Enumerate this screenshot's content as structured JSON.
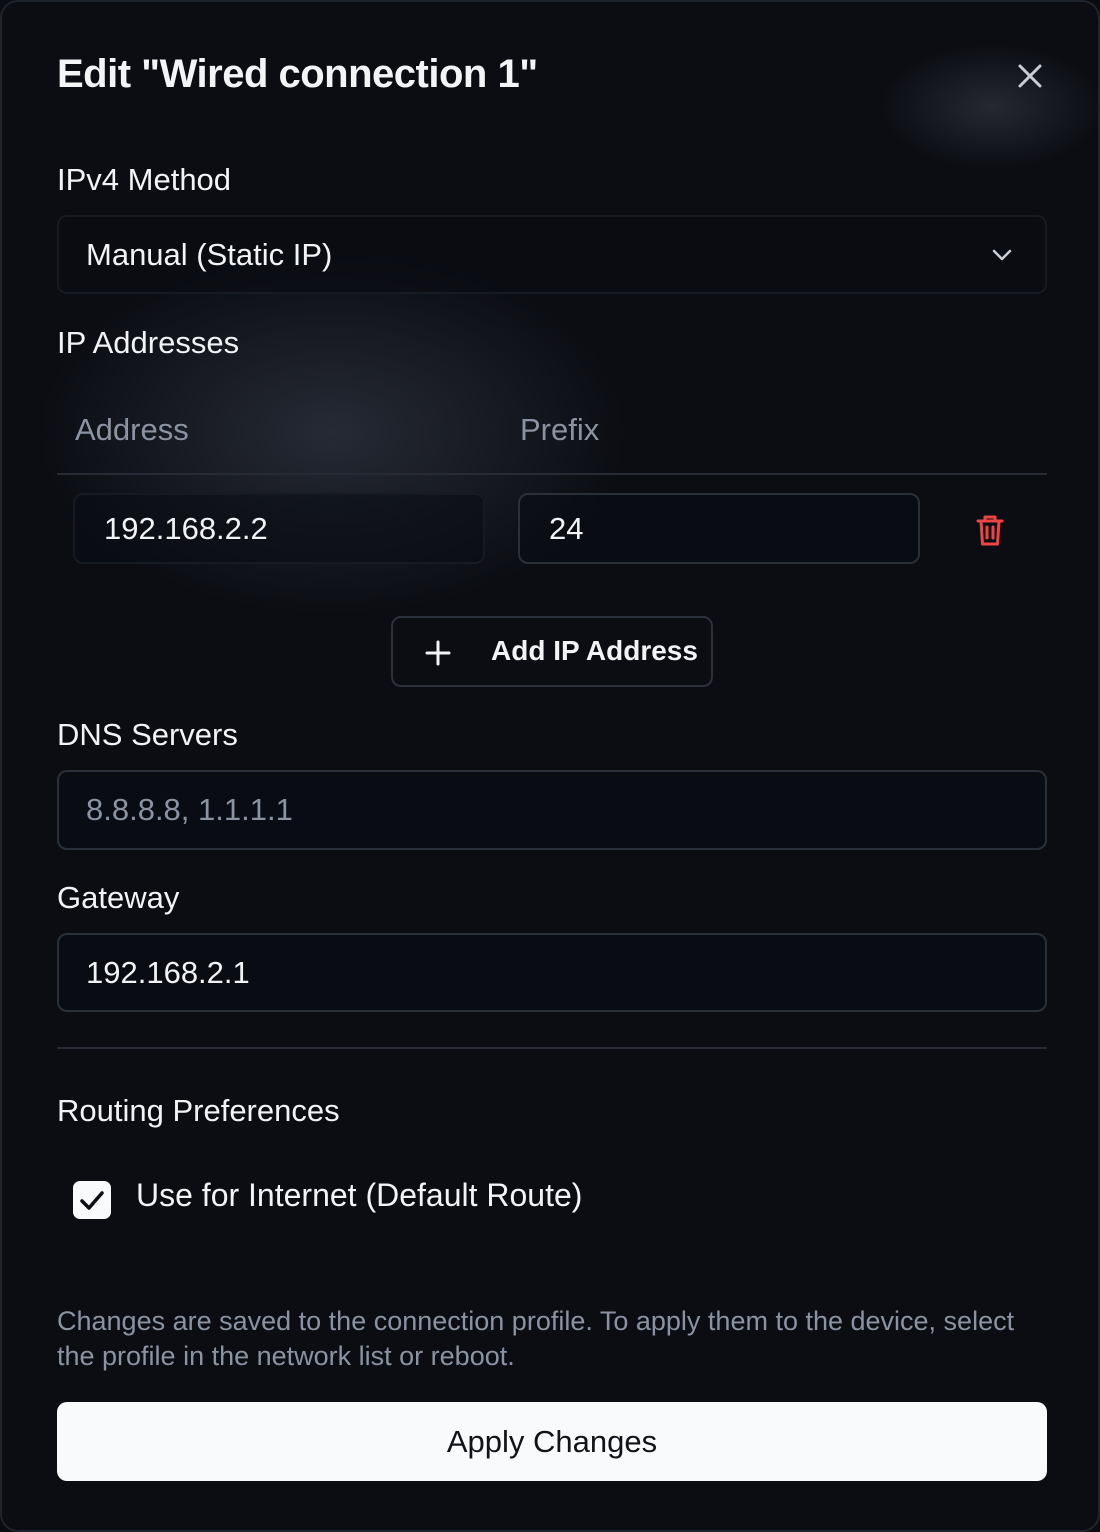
{
  "dialog": {
    "title": "Edit \"Wired connection 1\"",
    "close_icon": "close-icon"
  },
  "ipv4_method": {
    "label": "IPv4 Method",
    "selected": "Manual (Static IP)",
    "chevron_icon": "chevron-down-icon"
  },
  "ip_addresses": {
    "label": "IP Addresses",
    "columns": [
      "Address",
      "Prefix"
    ],
    "rows": [
      {
        "address": "192.168.2.2",
        "prefix": "24"
      }
    ],
    "delete_icon": "trash-icon",
    "delete_color": "#ef4444",
    "add_button_label": "Add IP Address",
    "add_icon": "plus-icon"
  },
  "dns": {
    "label": "DNS Servers",
    "placeholder": "8.8.8.8, 1.1.1.1"
  },
  "gateway": {
    "label": "Gateway",
    "value": "192.168.2.1"
  },
  "routing": {
    "label": "Routing Preferences",
    "default_route_label": "Use for Internet (Default Route)",
    "default_route_checked": true
  },
  "footer": {
    "note": "Changes are saved to the connection profile. To apply them to the device, select the profile in the network list or reboot.",
    "apply_label": "Apply Changes"
  }
}
